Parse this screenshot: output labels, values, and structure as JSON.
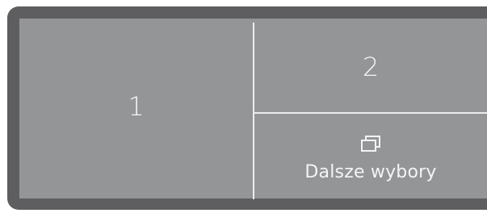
{
  "panel": {
    "button_1_label": "1",
    "button_2_label": "2",
    "more_options": {
      "label": "Dalsze wybory",
      "icon": "stacked-windows-icon"
    }
  },
  "colors": {
    "frame": "#5e5e60",
    "panel": "#949597",
    "text": "#f4f4f4",
    "divider": "#ececec"
  }
}
